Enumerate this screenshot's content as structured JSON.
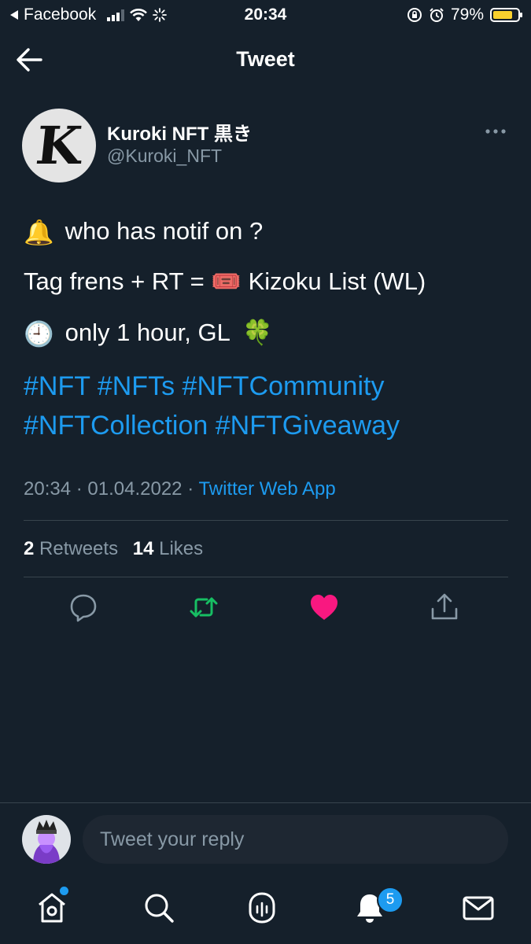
{
  "status_bar": {
    "back_app": "Facebook",
    "time": "20:34",
    "battery": "79%",
    "battery_level": 0.79
  },
  "header": {
    "title": "Tweet"
  },
  "author": {
    "name": "Kuroki NFT 黒き",
    "handle": "@Kuroki_NFT",
    "avatar_letter": "K"
  },
  "tweet": {
    "line1": "who has notif on ?",
    "line2": "Tag frens + RT = ",
    "line2_end": " Kizoku List (WL)",
    "line3": "only 1 hour, GL",
    "emoji1": "🔔",
    "emoji2": "🎟️",
    "emoji3": "🕘",
    "emoji4": "🍀",
    "hashtags": [
      "#NFT",
      "#NFTs",
      "#NFTCommunity",
      "#NFTCollection",
      "#NFTGiveaway"
    ]
  },
  "meta": {
    "time": "20:34",
    "date": "01.04.2022",
    "separator": "·",
    "source": "Twitter Web App"
  },
  "stats": {
    "retweets_count": "2",
    "retweets_label": "Retweets",
    "likes_count": "14",
    "likes_label": "Likes"
  },
  "actions": {
    "icons": [
      "reply-icon",
      "retweet-icon",
      "like-icon",
      "share-icon"
    ],
    "retweet_color": "#17bf63",
    "like_color": "#f91880"
  },
  "reply": {
    "placeholder": "Tweet your reply"
  },
  "bottom_nav": {
    "icons": [
      "home-icon",
      "search-icon",
      "spaces-icon",
      "notifications-icon",
      "messages-icon"
    ],
    "notifications_badge": "5"
  },
  "colors": {
    "background": "#15202b",
    "accent": "#1d9bf0",
    "secondary_text": "#8899a6"
  }
}
